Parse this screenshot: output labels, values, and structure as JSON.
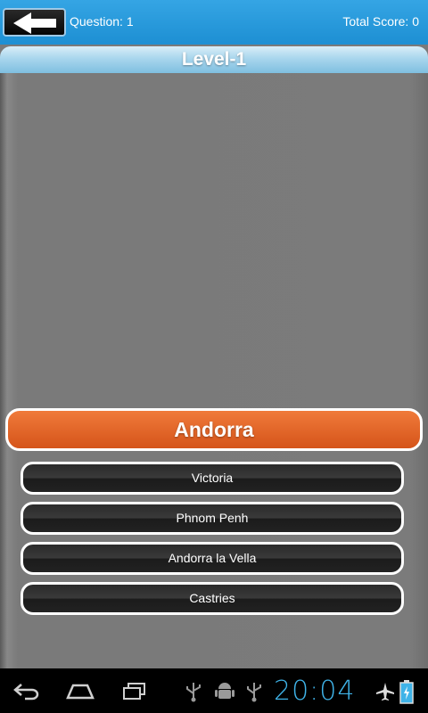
{
  "header": {
    "question_label": "Question: 1",
    "score_label": "Total Score: 0",
    "back_icon": "back-arrow-icon"
  },
  "level": {
    "title": "Level-1"
  },
  "quiz": {
    "country": "Andorra",
    "options": [
      "Victoria",
      "Phnom Penh",
      "Andorra la Vella",
      "Castries"
    ]
  },
  "system_bar": {
    "time": "20:04",
    "icons": [
      "back-icon",
      "home-icon",
      "recent-apps-icon",
      "usb-icon",
      "android-debug-icon",
      "usb-icon",
      "airplane-mode-icon",
      "battery-charging-icon"
    ]
  },
  "colors": {
    "header_blue": "#1d8fd3",
    "banner_orange": "#e2622a",
    "option_dark": "#222222",
    "clock_blue": "#3fb3e8"
  }
}
